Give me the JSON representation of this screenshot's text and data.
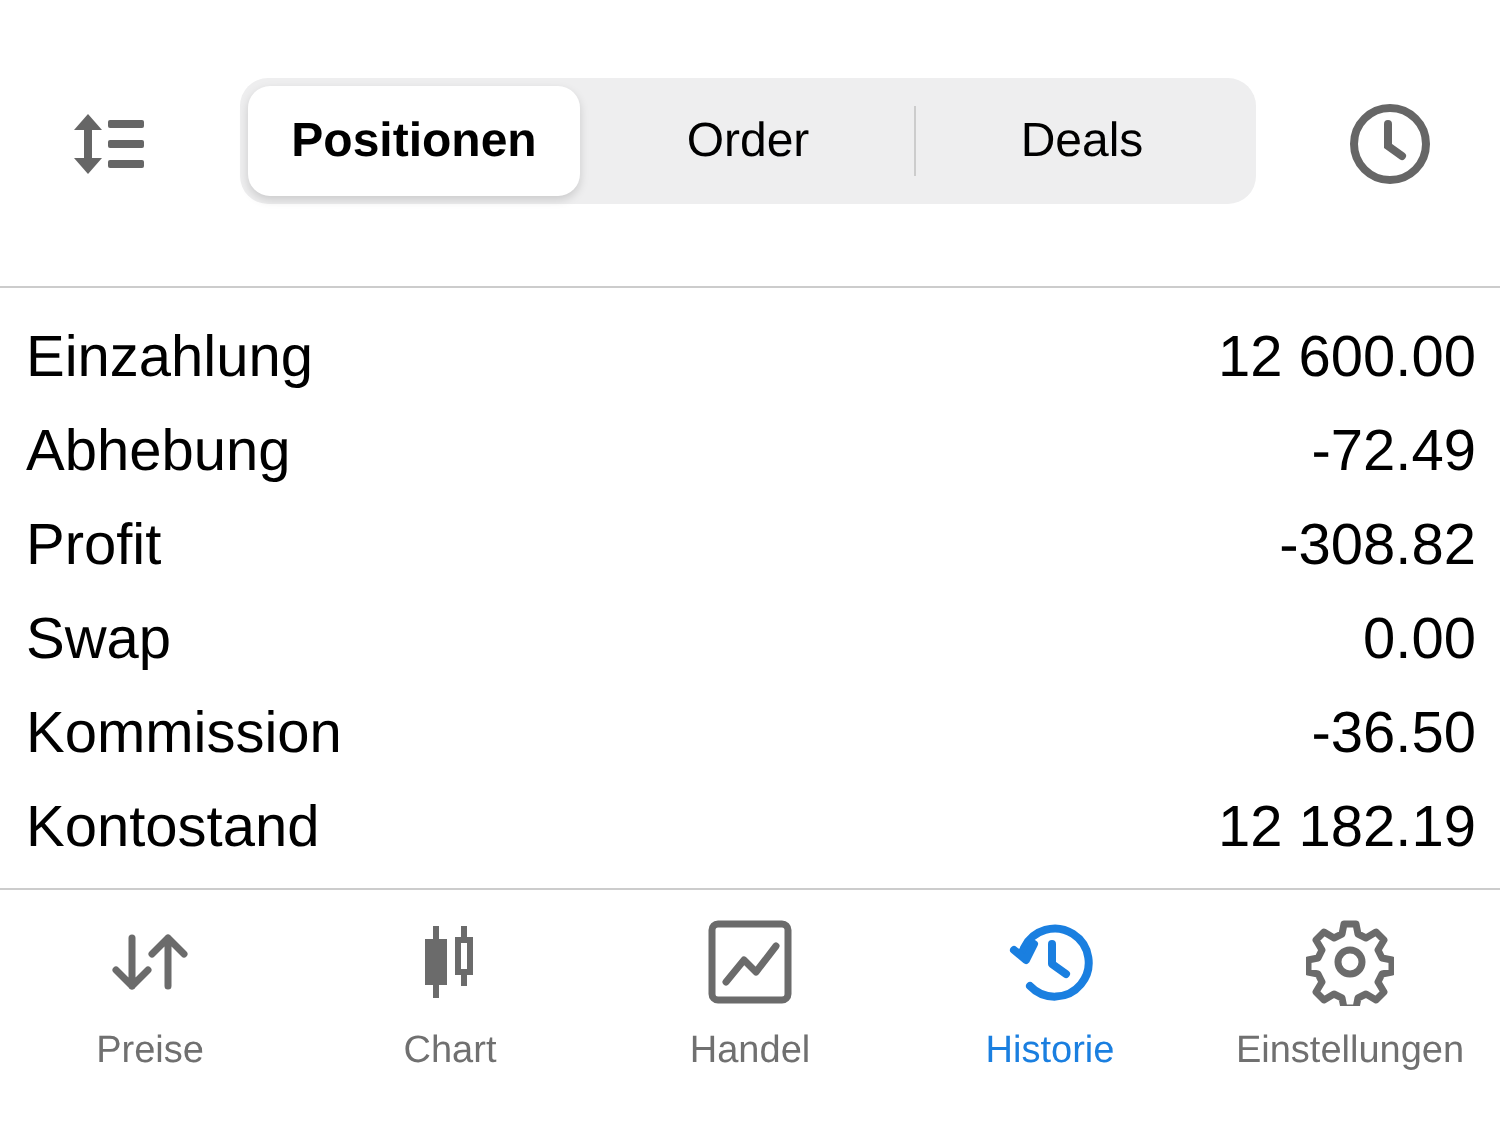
{
  "segments": [
    {
      "label": "Positionen",
      "selected": true
    },
    {
      "label": "Order",
      "selected": false
    },
    {
      "label": "Deals",
      "selected": false
    }
  ],
  "summary": [
    {
      "label": "Einzahlung",
      "value": "12 600.00"
    },
    {
      "label": "Abhebung",
      "value": "-72.49"
    },
    {
      "label": "Profit",
      "value": "-308.82"
    },
    {
      "label": "Swap",
      "value": "0.00"
    },
    {
      "label": "Kommission",
      "value": "-36.50"
    },
    {
      "label": "Kontostand",
      "value": "12 182.19"
    }
  ],
  "tab_bar": [
    {
      "label": "Preise",
      "selected": false
    },
    {
      "label": "Chart",
      "selected": false
    },
    {
      "label": "Handel",
      "selected": false
    },
    {
      "label": "Historie",
      "selected": true
    },
    {
      "label": "Einstellungen",
      "selected": false
    }
  ]
}
